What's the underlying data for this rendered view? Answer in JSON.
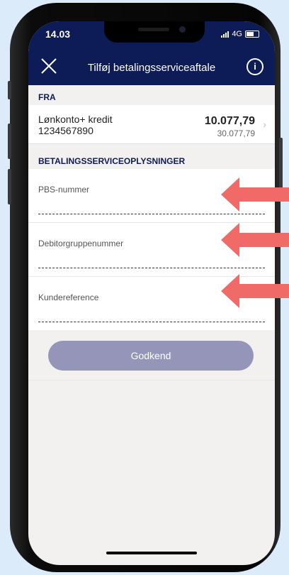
{
  "status_bar": {
    "time": "14.03",
    "network": "4G"
  },
  "header": {
    "title": "Tilføj betalingsserviceaftale",
    "close_icon": "close-icon",
    "info_icon": "info-icon",
    "info_glyph": "i"
  },
  "sections": {
    "from": "FRA",
    "payment_info": "BETALINGSSERVICEOPLYSNINGER"
  },
  "account": {
    "name": "Lønkonto+ kredit",
    "number": "1234567890",
    "balance": "10.077,79",
    "available": "30.077,79",
    "chevron": "›"
  },
  "fields": [
    {
      "label": "PBS-nummer",
      "value": ""
    },
    {
      "label": "Debitorgruppenummer",
      "value": ""
    },
    {
      "label": "Kundereference",
      "value": ""
    }
  ],
  "approve_button": {
    "label": "Godkend"
  },
  "colors": {
    "header": "#0d1b57",
    "button": "#9595ba",
    "arrow": "#f06a68",
    "background": "#dcebfa"
  }
}
